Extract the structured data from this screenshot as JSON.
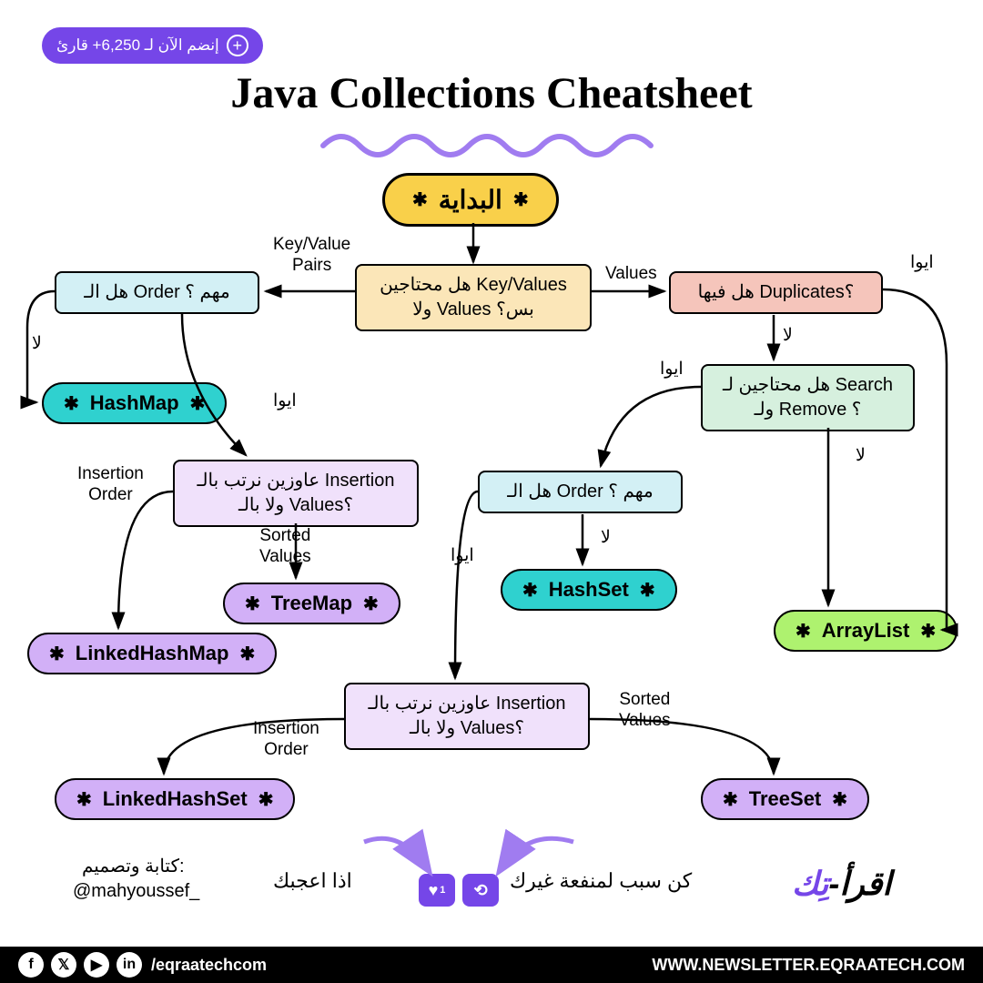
{
  "badge": {
    "text": "إنضم الآن لـ 6,250+ قارئ"
  },
  "title": "Java Collections Cheatsheet",
  "nodes": {
    "start": "البداية",
    "keyvalues": "هل محتاجين Key/Values ولا Values بس؟",
    "duplicates": "هل فيها Duplicates؟",
    "order1": "هل الـ Order مهم ؟",
    "search": "هل محتاجين لـ Search ولـ Remove ؟",
    "order2": "هل الـ Order مهم ؟",
    "insert1": "عاوزين نرتب بالـ Insertion ولا بالـ Values؟",
    "insert2": "عاوزين نرتب بالـ Insertion ولا بالـ Values؟",
    "hashmap": "HashMap",
    "treemap": "TreeMap",
    "linkedhashmap": "LinkedHashMap",
    "hashset": "HashSet",
    "arraylist": "ArrayList",
    "linkedhashset": "LinkedHashSet",
    "treeset": "TreeSet"
  },
  "edges": {
    "kvpairs": "Key/Value\nPairs",
    "values": "Values",
    "yes": "ايوا",
    "no": "لا",
    "insertion": "Insertion\nOrder",
    "sorted": "Sorted\nValues"
  },
  "footer": {
    "handle": "/eqraatechcom",
    "url": "WWW.NEWSLETTER.EQRAATECH.COM"
  },
  "credits": {
    "author_label": "كتابة وتصميم:",
    "author": "@mahyoussef_",
    "cta_left": "اذا اعجبك",
    "cta_right": "كن سبب لمنفعة غيرك",
    "like_count": "1"
  },
  "logo": {
    "part1": "اقرأ-",
    "part2": "تِك"
  }
}
